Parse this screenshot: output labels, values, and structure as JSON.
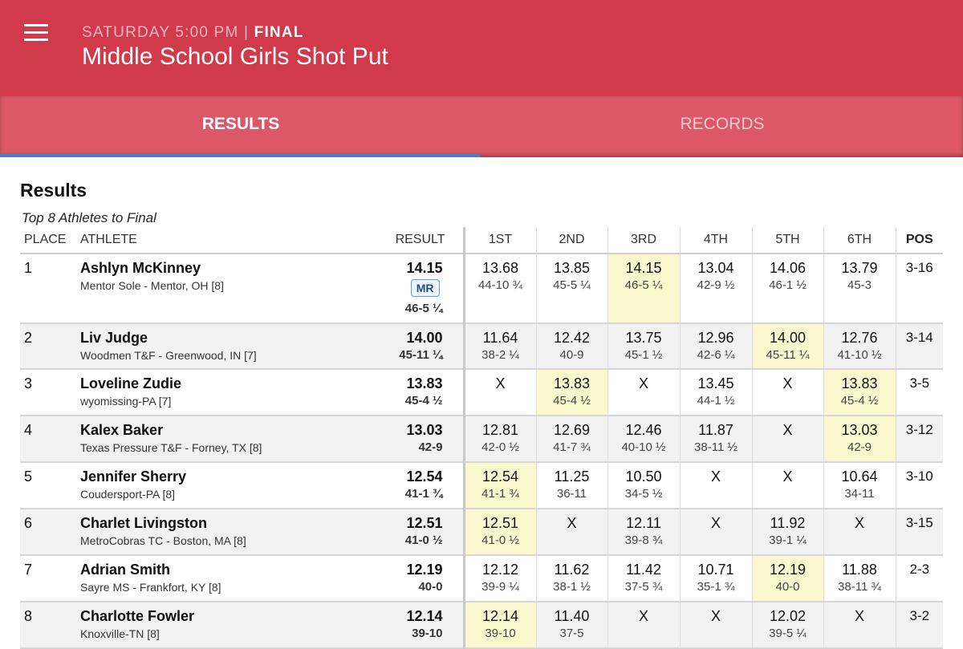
{
  "header": {
    "day_time": "SATURDAY 5:00 PM",
    "separator": " | ",
    "status": "FINAL",
    "title": "Middle School Girls Shot Put"
  },
  "tabs": [
    {
      "label": "RESULTS",
      "active": true
    },
    {
      "label": "RECORDS",
      "active": false
    }
  ],
  "section": {
    "title": "Results",
    "note": "Top 8 Athletes to Final"
  },
  "columns": [
    "PLACE",
    "ATHLETE",
    "RESULT",
    "1ST",
    "2ND",
    "3RD",
    "4TH",
    "5TH",
    "6TH",
    "POS"
  ],
  "colors": {
    "app_bar": "#d13a4b",
    "tab_bar": "#dc5767",
    "tab_indicator": "#3f7fd8",
    "best_mark_highlight": "#fbf8cf"
  },
  "rows": [
    {
      "place": "1",
      "name": "Ashlyn McKinney",
      "team": "Mentor Sole - Mentor, OH [8]",
      "result": "14.15",
      "badge": "MR",
      "result_imperial": "46-5 ¼",
      "attempts": [
        {
          "m": "13.68",
          "i": "44-10 ¾"
        },
        {
          "m": "13.85",
          "i": "45-5 ¼"
        },
        {
          "m": "14.15",
          "i": "46-5 ¼"
        },
        {
          "m": "13.04",
          "i": "42-9 ½"
        },
        {
          "m": "14.06",
          "i": "46-1 ½"
        },
        {
          "m": "13.79",
          "i": "45-3"
        }
      ],
      "best": 2,
      "pos": "3-16"
    },
    {
      "place": "2",
      "name": "Liv Judge",
      "team": "Woodmen T&F - Greenwood, IN [7]",
      "result": "14.00",
      "result_imperial": "45-11 ¼",
      "attempts": [
        {
          "m": "11.64",
          "i": "38-2 ¼"
        },
        {
          "m": "12.42",
          "i": "40-9"
        },
        {
          "m": "13.75",
          "i": "45-1 ½"
        },
        {
          "m": "12.96",
          "i": "42-6 ¼"
        },
        {
          "m": "14.00",
          "i": "45-11 ¼"
        },
        {
          "m": "12.76",
          "i": "41-10 ½"
        }
      ],
      "best": 4,
      "pos": "3-14"
    },
    {
      "place": "3",
      "name": "Loveline Zudie",
      "team": "wyomissing-PA [7]",
      "result": "13.83",
      "result_imperial": "45-4 ½",
      "attempts": [
        {
          "m": "X",
          "i": ""
        },
        {
          "m": "13.83",
          "i": "45-4 ½"
        },
        {
          "m": "X",
          "i": ""
        },
        {
          "m": "13.45",
          "i": "44-1 ½"
        },
        {
          "m": "X",
          "i": ""
        },
        {
          "m": "13.83",
          "i": "45-4 ½"
        }
      ],
      "best": [
        1,
        5
      ],
      "pos": "3-5"
    },
    {
      "place": "4",
      "name": "Kalex Baker",
      "team": "Texas Pressure T&F - Forney, TX [8]",
      "result": "13.03",
      "result_imperial": "42-9",
      "attempts": [
        {
          "m": "12.81",
          "i": "42-0 ½"
        },
        {
          "m": "12.69",
          "i": "41-7 ¾"
        },
        {
          "m": "12.46",
          "i": "40-10 ½"
        },
        {
          "m": "11.87",
          "i": "38-11 ½"
        },
        {
          "m": "X",
          "i": ""
        },
        {
          "m": "13.03",
          "i": "42-9"
        }
      ],
      "best": 5,
      "pos": "3-12"
    },
    {
      "place": "5",
      "name": "Jennifer Sherry",
      "team": "Coudersport-PA [8]",
      "result": "12.54",
      "result_imperial": "41-1 ¾",
      "attempts": [
        {
          "m": "12.54",
          "i": "41-1 ¾"
        },
        {
          "m": "11.25",
          "i": "36-11"
        },
        {
          "m": "10.50",
          "i": "34-5 ½"
        },
        {
          "m": "X",
          "i": ""
        },
        {
          "m": "X",
          "i": ""
        },
        {
          "m": "10.64",
          "i": "34-11"
        }
      ],
      "best": 0,
      "pos": "3-10"
    },
    {
      "place": "6",
      "name": "Charlet Livingston",
      "team": "MetroCobras TC - Boston, MA [8]",
      "result": "12.51",
      "result_imperial": "41-0 ½",
      "attempts": [
        {
          "m": "12.51",
          "i": "41-0 ½"
        },
        {
          "m": "X",
          "i": ""
        },
        {
          "m": "12.11",
          "i": "39-8 ¾"
        },
        {
          "m": "X",
          "i": ""
        },
        {
          "m": "11.92",
          "i": "39-1 ¼"
        },
        {
          "m": "X",
          "i": ""
        }
      ],
      "best": 0,
      "pos": "3-15"
    },
    {
      "place": "7",
      "name": "Adrian Smith",
      "team": "Sayre MS - Frankfort, KY [8]",
      "result": "12.19",
      "result_imperial": "40-0",
      "attempts": [
        {
          "m": "12.12",
          "i": "39-9 ¼"
        },
        {
          "m": "11.62",
          "i": "38-1 ½"
        },
        {
          "m": "11.42",
          "i": "37-5 ¾"
        },
        {
          "m": "10.71",
          "i": "35-1 ¾"
        },
        {
          "m": "12.19",
          "i": "40-0"
        },
        {
          "m": "11.88",
          "i": "38-11 ¾"
        }
      ],
      "best": 4,
      "pos": "2-3"
    },
    {
      "place": "8",
      "name": "Charlotte Fowler",
      "team": "Knoxville-TN [8]",
      "result": "12.14",
      "result_imperial": "39-10",
      "attempts": [
        {
          "m": "12.14",
          "i": "39-10"
        },
        {
          "m": "11.40",
          "i": "37-5"
        },
        {
          "m": "X",
          "i": ""
        },
        {
          "m": "X",
          "i": ""
        },
        {
          "m": "12.02",
          "i": "39-5 ¼"
        },
        {
          "m": "X",
          "i": ""
        }
      ],
      "best": 0,
      "pos": "3-2"
    }
  ]
}
